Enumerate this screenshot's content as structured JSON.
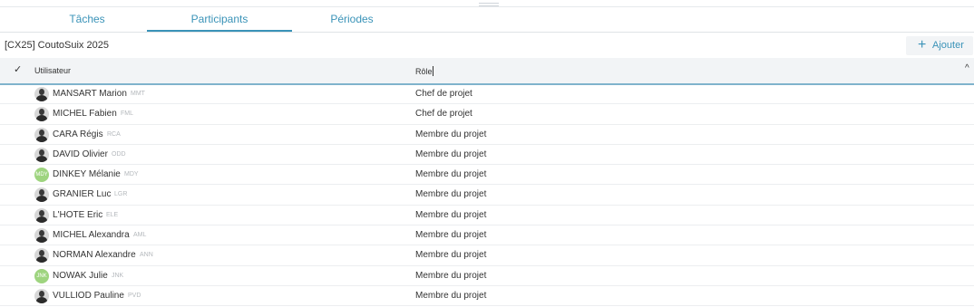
{
  "tabs": [
    {
      "label": "Tâches",
      "active": false
    },
    {
      "label": "Participants",
      "active": true
    },
    {
      "label": "Périodes",
      "active": false
    }
  ],
  "project": {
    "title": "[CX25] CoutoSuix 2025"
  },
  "add_button": {
    "label": "Ajouter",
    "icon": "plus-icon"
  },
  "table": {
    "check_icon": "✓",
    "columns": {
      "user": "Utilisateur",
      "role": "Rôle"
    },
    "sort_icon": "^",
    "rows": [
      {
        "name": "MANSART Marion",
        "code": "MMT",
        "role": "Chef de projet",
        "avatar": "photo"
      },
      {
        "name": "MICHEL Fabien",
        "code": "FML",
        "role": "Chef de projet",
        "avatar": "photo"
      },
      {
        "name": "CARA Régis",
        "code": "RCA",
        "role": "Membre du projet",
        "avatar": "photo"
      },
      {
        "name": "DAVID Olivier",
        "code": "ODD",
        "role": "Membre du projet",
        "avatar": "photo"
      },
      {
        "name": "DINKEY Mélanie",
        "code": "MDY",
        "role": "Membre du projet",
        "avatar": "initials",
        "initials": "MDY"
      },
      {
        "name": "GRANIER Luc",
        "code": "LGR",
        "role": "Membre du projet",
        "avatar": "photo"
      },
      {
        "name": "L'HOTE Eric",
        "code": "ELE",
        "role": "Membre du projet",
        "avatar": "photo"
      },
      {
        "name": "MICHEL Alexandra",
        "code": "AML",
        "role": "Membre du projet",
        "avatar": "photo"
      },
      {
        "name": "NORMAN Alexandre",
        "code": "ANN",
        "role": "Membre du projet",
        "avatar": "photo"
      },
      {
        "name": "NOWAK Julie",
        "code": "JNK",
        "role": "Membre du projet",
        "avatar": "initials",
        "initials": "JNK"
      },
      {
        "name": "VULLIOD Pauline",
        "code": "PVD",
        "role": "Membre du projet",
        "avatar": "photo"
      }
    ]
  },
  "colors": {
    "accent": "#3a93b8",
    "header_bg": "#f2f4f6",
    "initials_avatar": "#9ed47f"
  }
}
